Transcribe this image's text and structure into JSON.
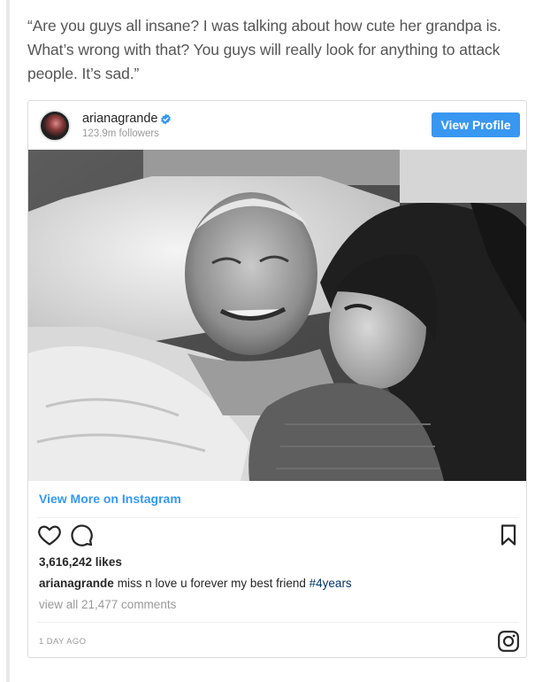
{
  "quote": {
    "line1": "“Are you guys all insane? I was talking about how cute her grandpa is.",
    "line2": "What’s wrong with that? You guys will really look for anything to attack",
    "line3": "people. It’s sad.”"
  },
  "embed": {
    "username": "arianagrande",
    "followers": "123.9m followers",
    "view_profile_label": "View Profile",
    "view_more_label": "View More on Instagram",
    "likes": "3,616,242 likes",
    "caption_user": "arianagrande",
    "caption_text": "miss n love u forever my best friend",
    "caption_hashtag": "#4years",
    "comments_link": "view all 21,477 comments",
    "timestamp": "1 DAY AGO",
    "accent_color": "#3897f0",
    "hashtag_color": "#003569"
  },
  "icons": {
    "like": "heart-icon",
    "comment": "comment-icon",
    "save": "bookmark-icon",
    "instagram": "instagram-logo-icon",
    "verified": "verified-badge-icon"
  }
}
